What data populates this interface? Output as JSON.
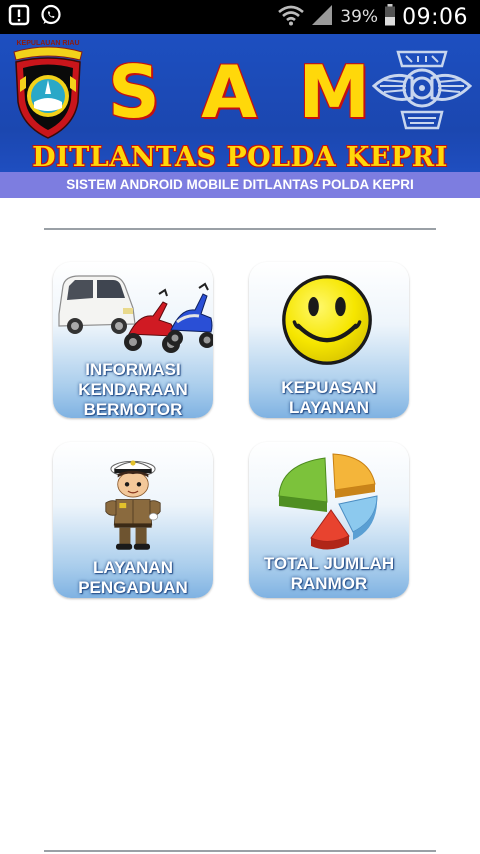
{
  "status_bar": {
    "battery_percent": "39%",
    "time": "09:06",
    "icons": [
      "notification-alert-icon",
      "whatsapp-icon",
      "wifi-icon",
      "signal-icon",
      "battery-icon"
    ]
  },
  "banner": {
    "title_letters": [
      "S",
      "A",
      "M"
    ],
    "subtitle": "DITLANTAS POLDA KEPRI",
    "left_logo_text": "KEPULAUAN RIAU",
    "title_color": "#ffd80a",
    "outline_color": "#c51010",
    "background_color": "#1d4fc0"
  },
  "app_subtitle": "SISTEM ANDROID MOBILE DITLANTAS POLDA KEPRI",
  "menu": {
    "tiles": [
      {
        "id": "informasi-kendaraan",
        "lines": [
          "INFORMASI",
          "KENDARAAN",
          "BERMOTOR"
        ],
        "icon": "car-motorbike-icon"
      },
      {
        "id": "kepuasan-layanan",
        "lines": [
          "KEPUASAN",
          "LAYANAN"
        ],
        "icon": "smiley-icon"
      },
      {
        "id": "layanan-pengaduan",
        "lines": [
          "LAYANAN",
          "PENGADUAN"
        ],
        "icon": "police-officer-icon"
      },
      {
        "id": "total-jumlah-ranmor",
        "lines": [
          "TOTAL JUMLAH",
          "RANMOR"
        ],
        "icon": "pie-chart-icon"
      }
    ]
  }
}
